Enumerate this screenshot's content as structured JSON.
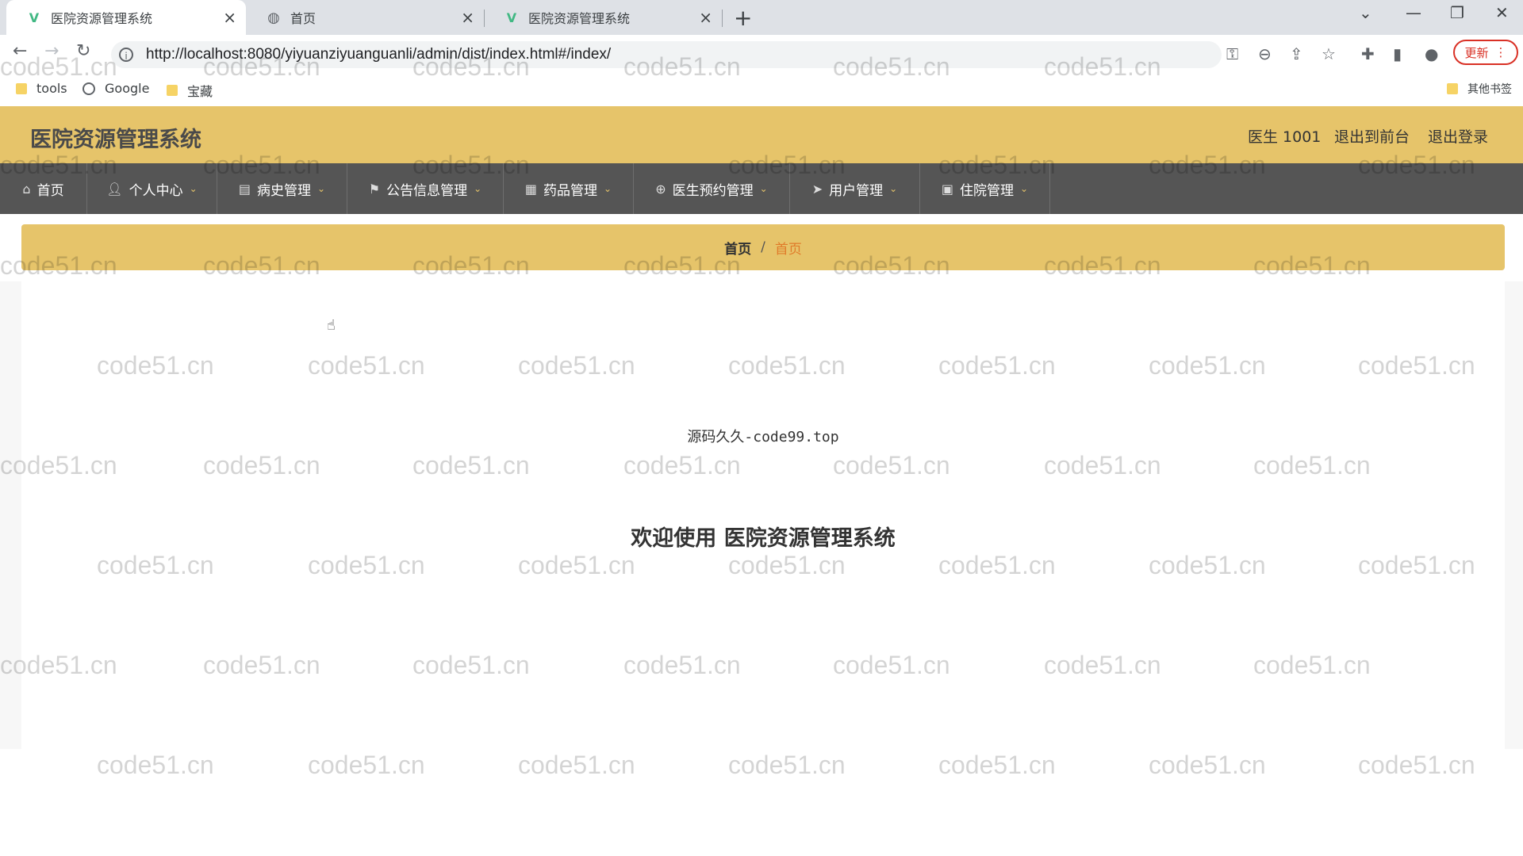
{
  "browser": {
    "tabs": [
      {
        "title": "医院资源管理系统",
        "active": true,
        "icon": "vue-icon"
      },
      {
        "title": "首页",
        "active": false,
        "icon": "globe-icon"
      },
      {
        "title": "医院资源管理系统",
        "active": false,
        "icon": "vue-icon"
      }
    ],
    "url": "http://localhost:8080/yiyuanziyuanguanli/admin/dist/index.html#/index/",
    "update_label": "更新",
    "bookmarks": [
      {
        "label": "tools",
        "icon": "folder-icon"
      },
      {
        "label": "Google",
        "icon": "globe-icon"
      },
      {
        "label": "宝藏",
        "icon": "folder-icon"
      }
    ],
    "other_bookmarks": "其他书签"
  },
  "header": {
    "title": "医院资源管理系统",
    "user": "医生 1001",
    "front_link": "退出到前台",
    "logout_link": "退出登录"
  },
  "nav": {
    "items": [
      {
        "label": "首页",
        "icon": "home-icon"
      },
      {
        "label": "个人中心",
        "icon": "user-icon"
      },
      {
        "label": "病史管理",
        "icon": "clipboard-icon"
      },
      {
        "label": "公告信息管理",
        "icon": "flag-icon"
      },
      {
        "label": "药品管理",
        "icon": "grid-icon"
      },
      {
        "label": "医生预约管理",
        "icon": "crosshair-icon"
      },
      {
        "label": "用户管理",
        "icon": "send-icon"
      },
      {
        "label": "住院管理",
        "icon": "monitor-icon"
      }
    ]
  },
  "breadcrumb": {
    "home": "首页",
    "separator": "/",
    "current": "首页"
  },
  "main": {
    "notice": "源码久久-code99.top",
    "welcome": "欢迎使用 医院资源管理系统"
  },
  "watermark": "code51.cn",
  "colors": {
    "accent": "#e6c46a",
    "nav_bg": "#555555",
    "breadcrumb_current": "#e07b2a"
  }
}
